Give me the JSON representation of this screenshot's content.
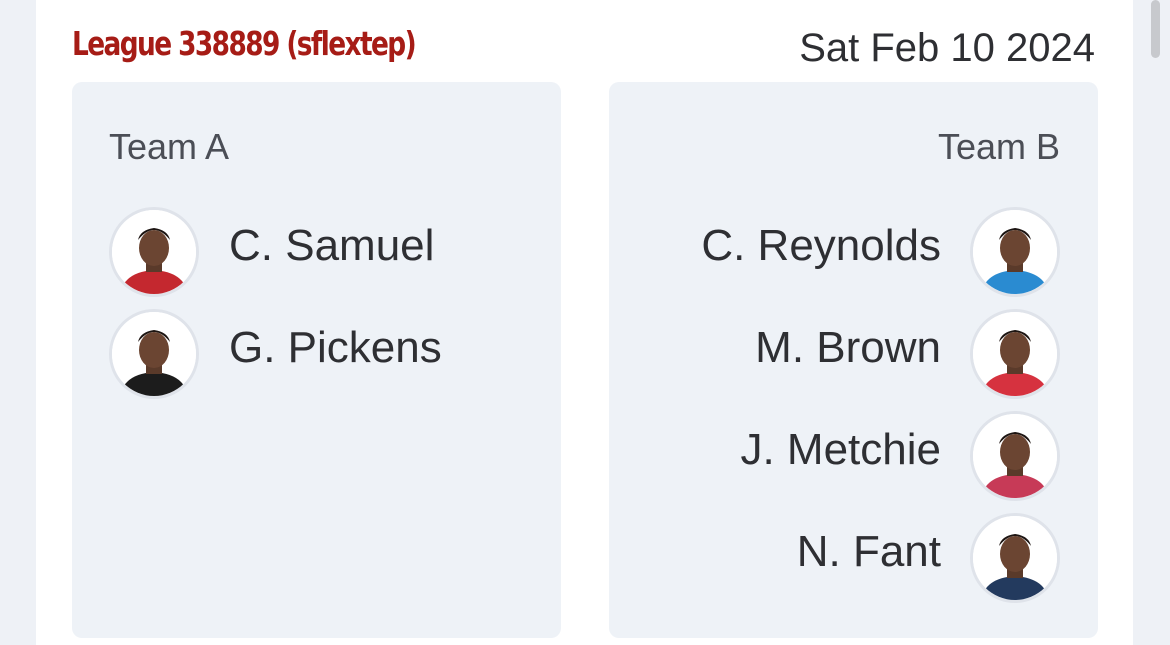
{
  "league": {
    "title": "League 338889 (sflextep)"
  },
  "trade": {
    "date": "Sat Feb 10 2024"
  },
  "teams": [
    {
      "name": "Team A",
      "players": [
        {
          "name": "C. Samuel",
          "jersey_color": "#c4282f",
          "icon": "player-headshot"
        },
        {
          "name": "G. Pickens",
          "jersey_color": "#1c1c1c",
          "icon": "player-headshot"
        }
      ]
    },
    {
      "name": "Team B",
      "players": [
        {
          "name": "C. Reynolds",
          "jersey_color": "#2a8bd1",
          "icon": "player-headshot"
        },
        {
          "name": "M. Brown",
          "jersey_color": "#d6323f",
          "icon": "player-headshot"
        },
        {
          "name": "J. Metchie",
          "jersey_color": "#c73a57",
          "icon": "player-headshot"
        },
        {
          "name": "N. Fant",
          "jersey_color": "#233a5e",
          "icon": "player-headshot"
        }
      ]
    }
  ]
}
